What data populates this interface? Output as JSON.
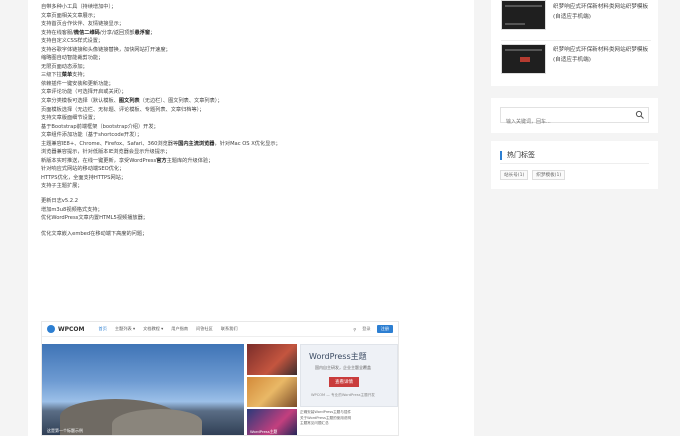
{
  "article": {
    "lines": [
      {
        "text": "自带多种小工具（持续增加中）；"
      },
      {
        "text": "文章页面相关文章展示；"
      },
      {
        "text": "支持首页合作伙伴、友情链接显示；"
      },
      {
        "pre": "支持在线客服/",
        "hl": "微信二维码",
        "post": "/分享/返回顶部",
        "hl2": "悬浮窗",
        "post2": "；"
      },
      {
        "text": "支持自定义CSS样式设置；"
      },
      {
        "text": "支持谷歌字体链接和头像链接替换，加快网站打开速度；"
      },
      {
        "text": "缩略图自动智能裁剪功能；"
      },
      {
        "text": "无限页面动态添加；"
      },
      {
        "pre": "三级下拉",
        "hl": "菜单",
        "post": "支持；"
      },
      {
        "text": "依赖插件一键安装和更新功能；"
      },
      {
        "text": "文章评论功能（可选择开启或关闭）；"
      },
      {
        "pre": "文章分类模板可选择（默认模板、",
        "hl": "图文列表",
        "post": "（无边栏）、图文列表、文章列表）；"
      },
      {
        "text": "页面模板选择（无边栏、无标题、评论模板、专题列表、文章归档等）；"
      },
      {
        "text": "支持文章版面细节设置；"
      },
      {
        "text": "基于Bootstrap前端框架（bootstrap介绍）开发；"
      },
      {
        "text": "文章组件添加功能（基于shortcode开发）；"
      },
      {
        "pre": "主题兼容IE8+、Chrome、Firefox、Safari、360浏览器等",
        "hl": "国内主流浏览器",
        "post": "，针对Mac OS X优化显示；"
      },
      {
        "text": "浏览器兼容提示，针对低版本IE浏览器会显示升级提示；"
      },
      {
        "pre": "新版本实时推送，在线一键更新，享受WordPress",
        "hl": "官方",
        "post": "主题库的升级体验；"
      },
      {
        "text": "针对响应式网站的移动端SEO优化；"
      },
      {
        "text": "HTTPS优化，全面支持HTTPS网站；"
      },
      {
        "text": "支持子主题扩展；"
      }
    ],
    "changelog": [
      "更新日志v5.2.2",
      "增加m3u8视频格式支持；",
      "优化WordPress文章内置HTML5视频播放器；"
    ],
    "note": "优化文章嵌入embed在移动端下高度的问题；"
  },
  "embedded_screenshot": {
    "logo": "WPCOM",
    "nav": [
      "首页",
      "主题列表 ▾",
      "文档教程 ▾",
      "用户指南",
      "问答社区",
      "联系我们"
    ],
    "nav_active_index": 0,
    "search_label": "登录",
    "register_label": "注册",
    "hero_caption": "这是第一个标题示例",
    "tile_captions": [
      "",
      "",
      "WordPress主题"
    ],
    "promo_title": "WordPress主题",
    "promo_sub": "国内自主研发，企业主题全覆盖",
    "promo_button": "查看详情",
    "promo_foot": "WPCOM — 专业的WordPress主题开发",
    "news": [
      "正确安装WordPress主题与插件",
      "关于WordPress主题的使用说明",
      "主题常见问题汇总"
    ]
  },
  "sidebar": {
    "posts": [
      {
        "title": "织梦响应式环保新材料类网站织梦模板(自适应手机端)"
      },
      {
        "title": "织梦响应式环保新材料类网站织梦模板(自适应手机端)"
      }
    ],
    "search": {
      "placeholder": "输入关键词，回车..."
    },
    "tags": {
      "title": "热门标签",
      "items": [
        "站长号(1)",
        "织梦模板(1)"
      ]
    }
  },
  "colors": {
    "accent": "#2d7fd2",
    "background": "#f4f4f4",
    "highlight_text": "#222222"
  }
}
